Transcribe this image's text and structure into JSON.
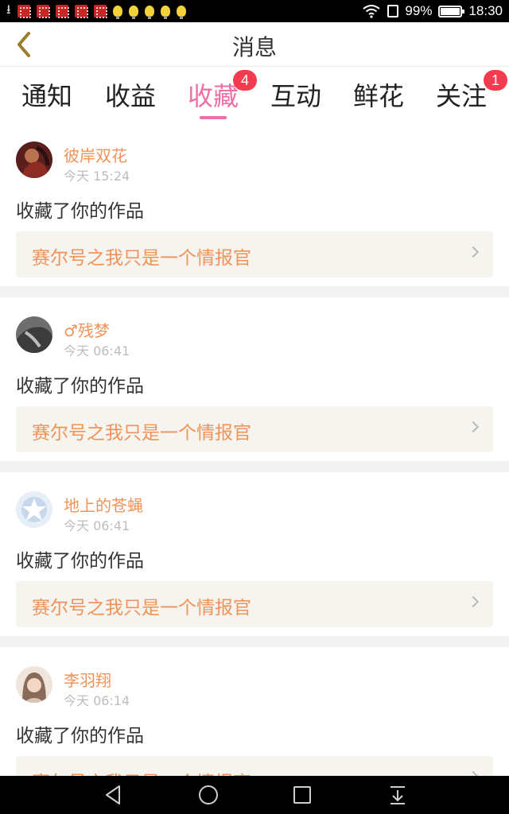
{
  "status_bar": {
    "battery": "99%",
    "time": "18:30",
    "icons": [
      "download-icon",
      "app-notification-icon",
      "bulb-notification-icon",
      "wifi-icon",
      "sim-icon",
      "battery-icon"
    ]
  },
  "header": {
    "title": "消息",
    "back_icon": "chevron-left-icon"
  },
  "tabs": [
    {
      "label": "通知",
      "active": false,
      "badge": ""
    },
    {
      "label": "收益",
      "active": false,
      "badge": ""
    },
    {
      "label": "收藏",
      "active": true,
      "badge": "4"
    },
    {
      "label": "互动",
      "active": false,
      "badge": ""
    },
    {
      "label": "鲜花",
      "active": false,
      "badge": ""
    },
    {
      "label": "关注",
      "active": false,
      "badge": "1"
    }
  ],
  "notifications": [
    {
      "user": "彼岸双花",
      "time": "今天 15:24",
      "action": "收藏了你的作品",
      "work": "赛尔号之我只是一个情报官"
    },
    {
      "user": "♂残梦",
      "time": "今天 06:41",
      "action": "收藏了你的作品",
      "work": "赛尔号之我只是一个情报官"
    },
    {
      "user": "地上的苍蝇",
      "time": "今天 06:41",
      "action": "收藏了你的作品",
      "work": "赛尔号之我只是一个情报官"
    },
    {
      "user": "李羽翔",
      "time": "今天 06:14",
      "action": "收藏了你的作品",
      "work": "赛尔号之我只是一个情报官"
    }
  ],
  "colors": {
    "accent": "#ee6fa5",
    "username": "#f0935a",
    "badge": "#f23b4f",
    "work_box_bg": "#f6f4ee"
  },
  "navbar": {
    "icons": [
      "back-triangle-icon",
      "home-circle-icon",
      "recents-square-icon",
      "notification-pull-icon"
    ]
  }
}
